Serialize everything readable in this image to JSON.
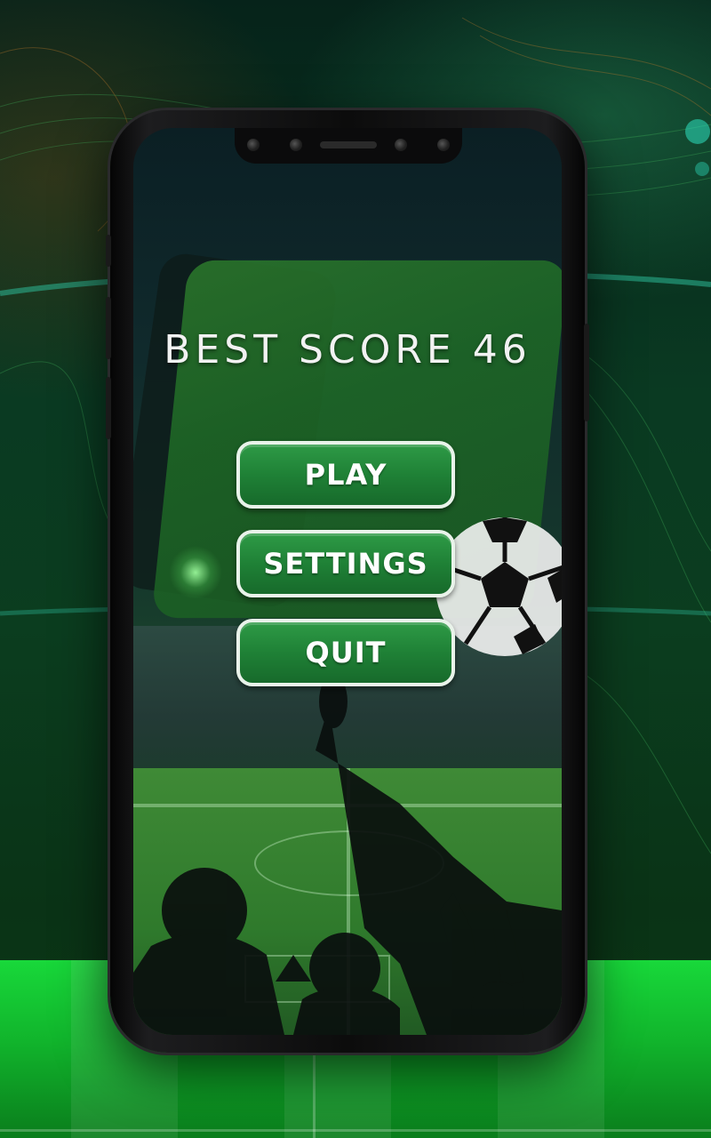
{
  "menu": {
    "best_score": "BEST SCORE 46",
    "play_label": "PLAY",
    "settings_label": "SETTINGS",
    "quit_label": "QUIT"
  },
  "colors": {
    "background": "#0b3d1f",
    "floor": "#18d83a",
    "button_fill": "#1f8136",
    "button_border": "#e9f3ea",
    "title_text": "#f2f2f2"
  },
  "icons": [
    "soccer-ball-icon",
    "front-camera-icon",
    "speaker-icon"
  ]
}
